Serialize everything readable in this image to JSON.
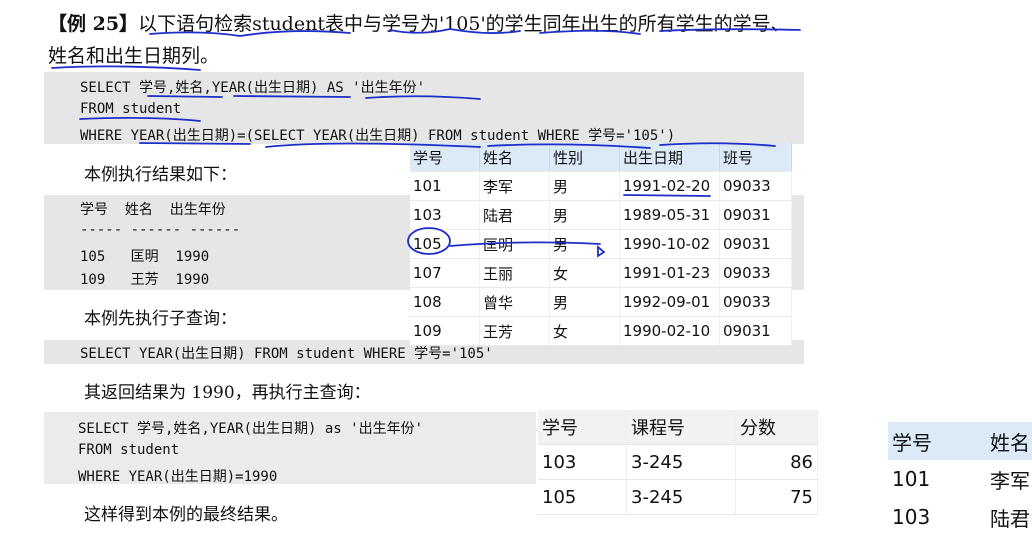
{
  "example_title": {
    "label": "【例 25】",
    "text": "以下语句检索student表中与学号为'105'的学生同年出生的所有学生的学号、姓名和出生日期列。"
  },
  "code_block_1": [
    "SELECT 学号,姓名,YEAR(出生日期) AS '出生年份'",
    "FROM student",
    "WHERE YEAR(出生日期)=(SELECT YEAR(出生日期) FROM student WHERE 学号='105')"
  ],
  "result_intro": "本例执行结果如下：",
  "result_block": [
    "学号  姓名  出生年份",
    "----- ------ ------",
    "105   匡明  1990",
    "109   王芳  1990"
  ],
  "subquery_intro": "本例先执行子查询：",
  "code_block_2": "SELECT YEAR(出生日期) FROM student WHERE 学号='105'",
  "return_text": "其返回结果为 1990，再执行主查询：",
  "code_block_3": [
    "SELECT 学号,姓名,YEAR(出生日期) as '出生年份'",
    "FROM student",
    "WHERE YEAR(出生日期)=1990"
  ],
  "final_text": "这样得到本例的最终结果。",
  "student_table": {
    "headers": [
      "学号",
      "姓名",
      "性别",
      "出生日期",
      "班号"
    ],
    "rows": [
      [
        "101",
        "李军",
        "男",
        "1991-02-20",
        "09033"
      ],
      [
        "103",
        "陆君",
        "男",
        "1989-05-31",
        "09031"
      ],
      [
        "105",
        "匡明",
        "男",
        "1990-10-02",
        "09031"
      ],
      [
        "107",
        "王丽",
        "女",
        "1991-01-23",
        "09033"
      ],
      [
        "108",
        "曾华",
        "男",
        "1992-09-01",
        "09033"
      ],
      [
        "109",
        "王芳",
        "女",
        "1990-02-10",
        "09031"
      ]
    ]
  },
  "score_table": {
    "headers": [
      "学号",
      "课程号",
      "分数"
    ],
    "rows": [
      [
        "103",
        "3-245",
        "86"
      ],
      [
        "105",
        "3-245",
        "75"
      ]
    ]
  },
  "partial_table": {
    "headers": [
      "学号",
      "姓名"
    ],
    "rows": [
      [
        "101",
        "李军"
      ],
      [
        "103",
        "陆君"
      ]
    ]
  },
  "annotation_color": "#1d2fc8"
}
